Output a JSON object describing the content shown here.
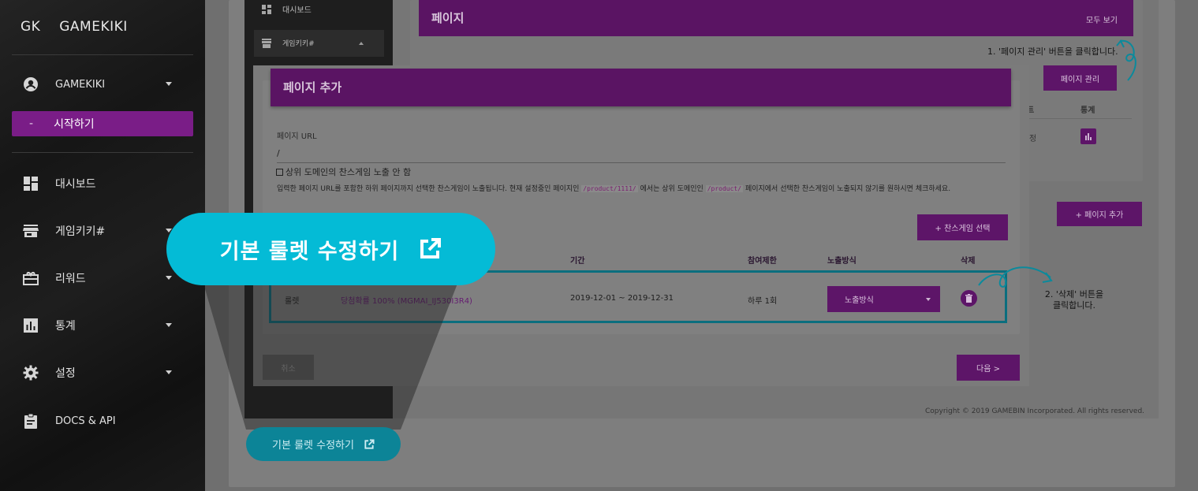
{
  "sidebar": {
    "brand_short": "GK",
    "brand_name": "GAMEKIKI",
    "account": "GAMEKIKI",
    "active": {
      "dash": "-",
      "label": "시작하기"
    },
    "items": [
      {
        "label": "대시보드",
        "icon": "dashboard-icon"
      },
      {
        "label": "게임키키#",
        "icon": "store-icon"
      },
      {
        "label": "리워드",
        "icon": "gift-icon"
      },
      {
        "label": "통계",
        "icon": "bar-chart-icon"
      },
      {
        "label": "설정",
        "icon": "gear-icon"
      },
      {
        "label": "DOCS & API",
        "icon": "clipboard-icon"
      }
    ]
  },
  "bg": {
    "inner_nav": {
      "dashboard": "대시보드",
      "gamekiki": "게임키키#"
    },
    "page_title": "페이지",
    "view_all": "모두 보기",
    "step1": "1. '페이지 관리' 버튼을 클릭합니다.",
    "manage_button": "페이지 관리",
    "col_stats": "통계",
    "add_page_button": "+ 페이지 추가",
    "step2_line1": "2. '삭제' 버튼을",
    "step2_line2": "클릭합니다.",
    "copyright": "Copyright © 2019 GAMEBIN Incorporated. All rights reserved."
  },
  "modal": {
    "title": "페이지 추가",
    "url_label": "페이지 URL",
    "url_value": "/",
    "checkbox_label": "상위 도메인의 찬스게임 노출 안 함",
    "note_a": "입력한 페이지 URL를 포함한 하위 페이지까지 선택한 찬스게임이 노출됩니다. 현재 설정중인 페이지인",
    "note_code1": "/product/1111/",
    "note_b": "에서는 상위 도메인인",
    "note_code2": "/product/",
    "note_c": "페이지에서 선택한 찬스게임이 노출되지 않기를 원하시면 체크하세요.",
    "select_game_button": "+ 찬스게임 선택",
    "columns": {
      "period": "기간",
      "limit": "참여제한",
      "exposure": "노출방식",
      "delete": "삭제"
    },
    "row": {
      "type": "룰렛",
      "name": "당첨확률 100% (MGMAI_IJ530I3R4)",
      "period": "2019-12-01 ~ 2019-12-31",
      "limit": "하루 1회",
      "exposure": "노출방식"
    },
    "cancel_button": "취소",
    "next_button": "다음 >"
  },
  "callout": {
    "big_label": "기본 룰렛 수정하기",
    "small_label": "기본 룰렛 수정하기"
  },
  "colors": {
    "accent": "#7a1d87",
    "callout": "#04bbd6",
    "highlight": "#0b6e7e"
  }
}
